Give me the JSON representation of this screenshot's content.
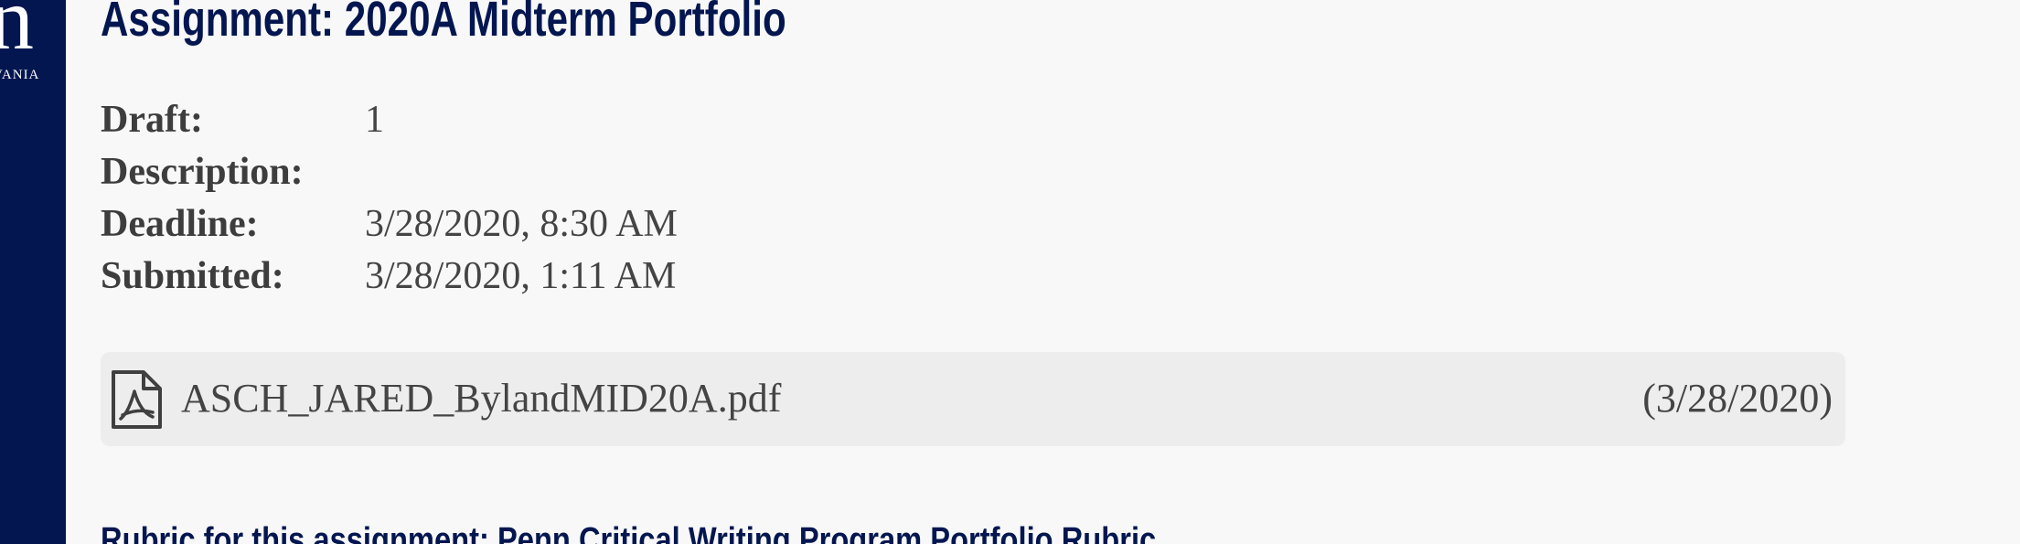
{
  "branding": {
    "logo_letter": "n",
    "logo_subtext": "VANIA",
    "sidebar_color": "#031650"
  },
  "assignment": {
    "title": "Assignment: 2020A Midterm Portfolio",
    "details": [
      {
        "label": "Draft:",
        "value": "1"
      },
      {
        "label": "Description:",
        "value": ""
      },
      {
        "label": "Deadline:",
        "value": "3/28/2020, 8:30 AM"
      },
      {
        "label": "Submitted:",
        "value": "3/28/2020, 1:11 AM"
      }
    ]
  },
  "submission_file": {
    "icon": "pdf-file-icon",
    "name": "ASCH_JARED_BylandMID20A.pdf",
    "date": "(3/28/2020)"
  },
  "rubric": {
    "heading": "Rubric for this assignment: Penn Critical Writing Program Portfolio Rubric"
  },
  "colors": {
    "title": "#031650",
    "text": "#3a3a3a",
    "background": "#f8f8f8",
    "file_card": "#ededed"
  }
}
